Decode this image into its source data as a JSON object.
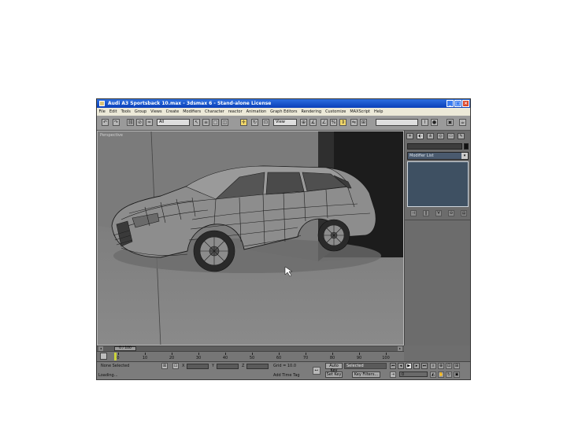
{
  "window": {
    "title": "Audi A3 Sportsback 10.max - 3dsmax 6 - Stand-alone License",
    "buttons": {
      "minimize": "_",
      "maximize": "□",
      "close": "×"
    }
  },
  "menu": [
    "File",
    "Edit",
    "Tools",
    "Group",
    "Views",
    "Create",
    "Modifiers",
    "Character",
    "reactor",
    "Animation",
    "Graph Editors",
    "Rendering",
    "Customize",
    "MAXScript",
    "Help"
  ],
  "toolbar": {
    "selection_filter": "All",
    "coordinate_system": "View",
    "named_selection": "",
    "icons": [
      "undo-icon",
      "redo-icon",
      "link-icon",
      "unlink-icon",
      "bind-space-warp-icon",
      "select-object-icon",
      "select-by-name-icon",
      "rectangle-selection-icon",
      "window-crossing-icon",
      "move-icon",
      "rotate-icon",
      "scale-icon",
      "pivot-icon",
      "mirror-icon",
      "align-icon",
      "curve-editor-icon",
      "material-editor-icon",
      "render-scene-icon",
      "quick-render-icon"
    ]
  },
  "viewport": {
    "label": "Perspective"
  },
  "command_panel": {
    "tabs": [
      "create-tab-icon",
      "modify-tab-icon",
      "hierarchy-tab-icon",
      "motion-tab-icon",
      "display-tab-icon",
      "utilities-tab-icon"
    ],
    "object_name": "",
    "modifier_list": "Modifier List",
    "stack_buttons": [
      "pin-stack-icon",
      "show-end-result-icon",
      "make-unique-icon",
      "remove-modifier-icon",
      "configure-modifier-sets-icon"
    ]
  },
  "time_slider": {
    "position_label": "0 / 100"
  },
  "trackbar": {
    "ticks": [
      "0",
      "10",
      "20",
      "30",
      "40",
      "50",
      "60",
      "70",
      "80",
      "90",
      "100"
    ]
  },
  "status": {
    "selection_text": "None Selected",
    "prompt_text": "Loading...",
    "x_label": "X",
    "y_label": "Y",
    "z_label": "Z",
    "grid_text": "Grid = 10.0",
    "add_time_tag": "Add Time Tag",
    "auto_key": "Auto Key",
    "selected_dropdown": "Selected",
    "set_key": "Set Key",
    "key_filters": "Key Filters...",
    "current_frame": "0"
  },
  "colors": {
    "title_bar": "#0a3fb8",
    "viewport_bg": "#7a7a7a",
    "stack_view": "#3e5062",
    "active_tool": "#f2d86b"
  }
}
